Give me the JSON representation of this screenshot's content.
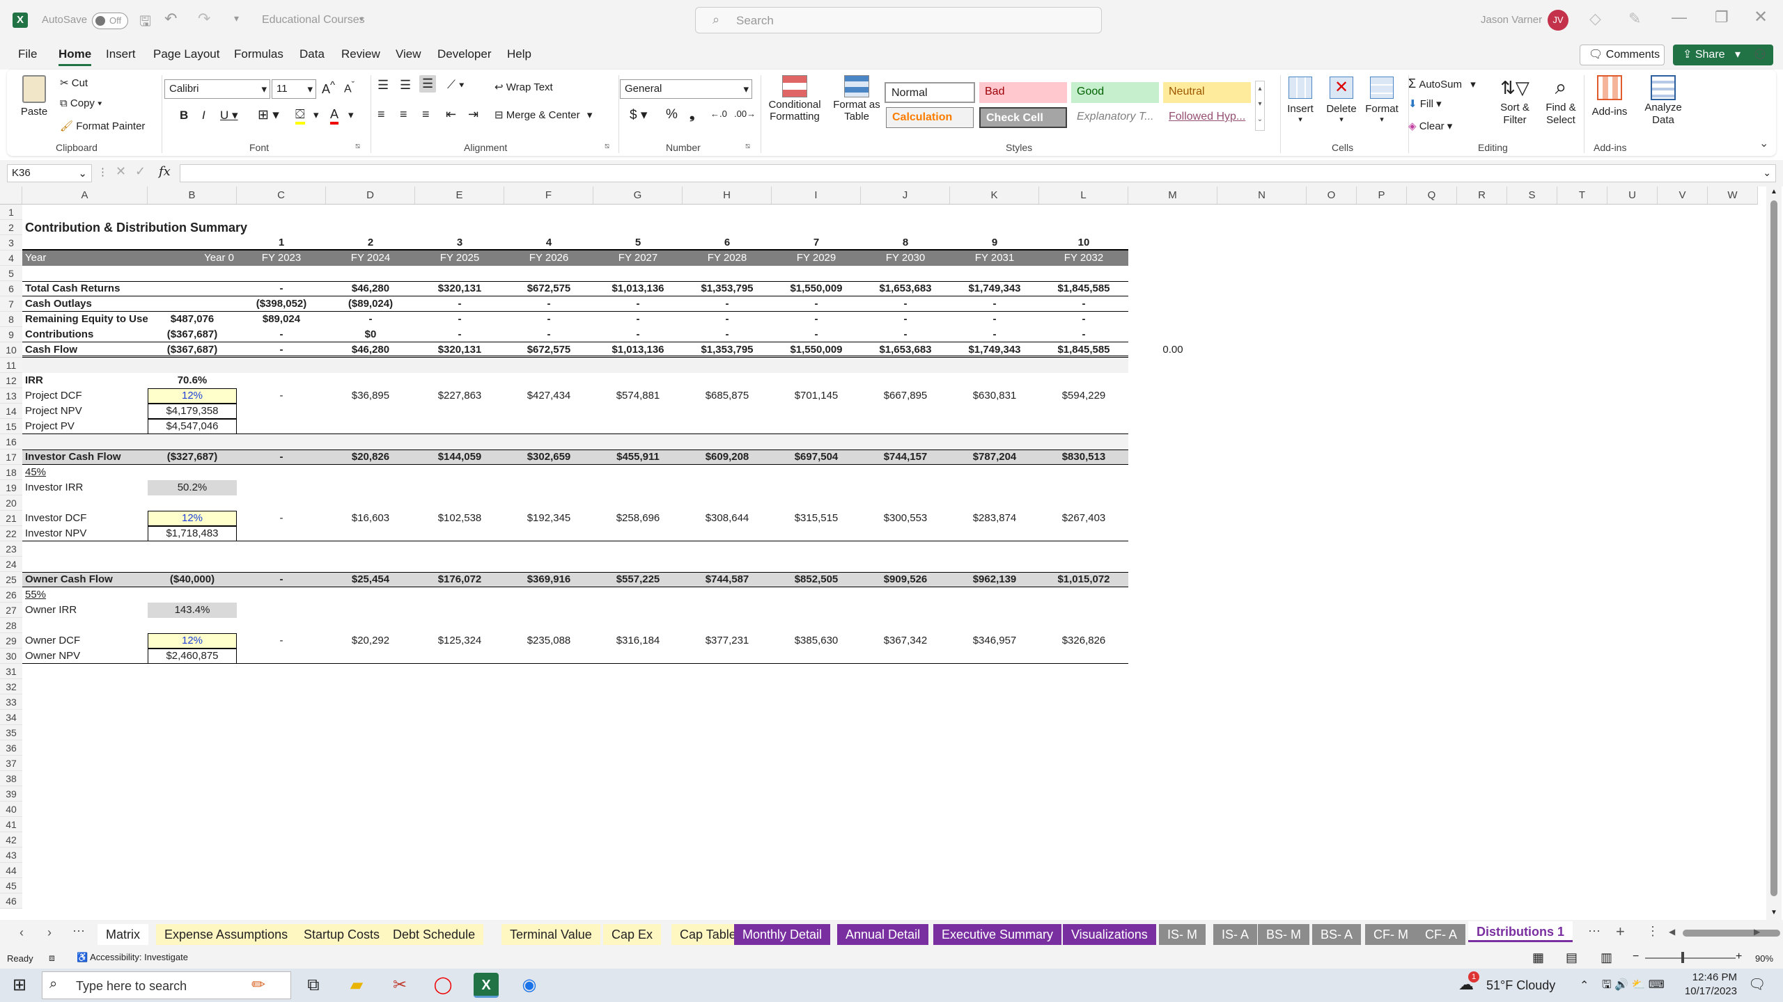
{
  "titlebar": {
    "autosave_label": "AutoSave",
    "autosave_state": "Off",
    "file_name": "Educational Courses",
    "search_placeholder": "Search",
    "user_name": "Jason Varner",
    "user_initials": "JV"
  },
  "menu": [
    "File",
    "Home",
    "Insert",
    "Page Layout",
    "Formulas",
    "Data",
    "Review",
    "View",
    "Developer",
    "Help"
  ],
  "menu_active": "Home",
  "comments_label": "Comments",
  "share_label": "Share",
  "ribbon": {
    "clipboard": {
      "paste": "Paste",
      "cut": "Cut",
      "copy": "Copy",
      "format_painter": "Format Painter",
      "group": "Clipboard"
    },
    "font": {
      "name": "Calibri",
      "size": "11",
      "group": "Font"
    },
    "alignment": {
      "wrap": "Wrap Text",
      "merge": "Merge & Center",
      "group": "Alignment"
    },
    "number": {
      "format": "General",
      "group": "Number"
    },
    "styles": {
      "conditional": "Conditional Formatting",
      "format_table": "Format as Table",
      "normal": "Normal",
      "bad": "Bad",
      "good": "Good",
      "neutral": "Neutral",
      "calculation": "Calculation",
      "check": "Check Cell",
      "explanatory": "Explanatory T...",
      "followed": "Followed Hyp...",
      "group": "Styles"
    },
    "cells": {
      "insert": "Insert",
      "delete": "Delete",
      "format": "Format",
      "group": "Cells"
    },
    "editing": {
      "autosum": "AutoSum",
      "fill": "Fill",
      "clear": "Clear",
      "sort": "Sort & Filter",
      "find": "Find & Select",
      "group": "Editing"
    },
    "addins": {
      "addins": "Add-ins",
      "analyze": "Analyze Data",
      "group": "Add-ins"
    }
  },
  "namebox": "K36",
  "fx": "fx",
  "columns": [
    "A",
    "B",
    "C",
    "D",
    "E",
    "F",
    "G",
    "H",
    "I",
    "J",
    "K",
    "L",
    "M",
    "N",
    "O",
    "P",
    "Q",
    "R",
    "S",
    "T",
    "U",
    "V",
    "W"
  ],
  "rows": {
    "r2": {
      "A": "Contribution & Distribution Summary"
    },
    "r3": {
      "C": "1",
      "D": "2",
      "E": "3",
      "F": "4",
      "G": "5",
      "H": "6",
      "I": "7",
      "J": "8",
      "K": "9",
      "L": "10"
    },
    "r4": {
      "A": "Year",
      "B": "Year 0",
      "C": "FY 2023",
      "D": "FY 2024",
      "E": "FY 2025",
      "F": "FY 2026",
      "G": "FY 2027",
      "H": "FY 2028",
      "I": "FY 2029",
      "J": "FY 2030",
      "K": "FY 2031",
      "L": "FY 2032"
    },
    "r6": {
      "A": "Total Cash Returns",
      "C": "-",
      "D": "$46,280",
      "E": "$320,131",
      "F": "$672,575",
      "G": "$1,013,136",
      "H": "$1,353,795",
      "I": "$1,550,009",
      "J": "$1,653,683",
      "K": "$1,749,343",
      "L": "$1,845,585"
    },
    "r7": {
      "A": "Cash Outlays",
      "C": "($398,052)",
      "D": "($89,024)",
      "E": "-",
      "F": "-",
      "G": "-",
      "H": "-",
      "I": "-",
      "J": "-",
      "K": "-",
      "L": "-"
    },
    "r8": {
      "A": "Remaining Equity to Use",
      "B": "$487,076",
      "C": "$89,024",
      "D": "-",
      "E": "-",
      "F": "-",
      "G": "-",
      "H": "-",
      "I": "-",
      "J": "-",
      "K": "-",
      "L": "-"
    },
    "r9": {
      "A": "Contributions",
      "B": "($367,687)",
      "C": "-",
      "D": "$0",
      "E": "-",
      "F": "-",
      "G": "-",
      "H": "-",
      "I": "-",
      "J": "-",
      "K": "-",
      "L": "-"
    },
    "r10": {
      "A": "Cash Flow",
      "B": "($367,687)",
      "C": "-",
      "D": "$46,280",
      "E": "$320,131",
      "F": "$672,575",
      "G": "$1,013,136",
      "H": "$1,353,795",
      "I": "$1,550,009",
      "J": "$1,653,683",
      "K": "$1,749,343",
      "L": "$1,845,585",
      "M": "0.00"
    },
    "r12": {
      "A": "IRR",
      "B": "70.6%"
    },
    "r13": {
      "A": "Project DCF",
      "B": "12%",
      "C": "-",
      "D": "$36,895",
      "E": "$227,863",
      "F": "$427,434",
      "G": "$574,881",
      "H": "$685,875",
      "I": "$701,145",
      "J": "$667,895",
      "K": "$630,831",
      "L": "$594,229"
    },
    "r14": {
      "A": "Project NPV",
      "B": "$4,179,358"
    },
    "r15": {
      "A": "Project PV",
      "B": "$4,547,046"
    },
    "r17": {
      "A": "Investor Cash Flow",
      "B": "($327,687)",
      "C": "-",
      "D": "$20,826",
      "E": "$144,059",
      "F": "$302,659",
      "G": "$455,911",
      "H": "$609,208",
      "I": "$697,504",
      "J": "$744,157",
      "K": "$787,204",
      "L": "$830,513"
    },
    "r18": {
      "A": "45%"
    },
    "r19": {
      "A": "Investor IRR",
      "B": "50.2%"
    },
    "r21": {
      "A": "Investor DCF",
      "B": "12%",
      "C": "-",
      "D": "$16,603",
      "E": "$102,538",
      "F": "$192,345",
      "G": "$258,696",
      "H": "$308,644",
      "I": "$315,515",
      "J": "$300,553",
      "K": "$283,874",
      "L": "$267,403"
    },
    "r22": {
      "A": "Investor NPV",
      "B": "$1,718,483"
    },
    "r25": {
      "A": "Owner Cash Flow",
      "B": "($40,000)",
      "C": "-",
      "D": "$25,454",
      "E": "$176,072",
      "F": "$369,916",
      "G": "$557,225",
      "H": "$744,587",
      "I": "$852,505",
      "J": "$909,526",
      "K": "$962,139",
      "L": "$1,015,072"
    },
    "r26": {
      "A": "55%"
    },
    "r27": {
      "A": "Owner IRR",
      "B": "143.4%"
    },
    "r29": {
      "A": "Owner DCF",
      "B": "12%",
      "C": "-",
      "D": "$20,292",
      "E": "$125,324",
      "F": "$235,088",
      "G": "$316,184",
      "H": "$377,231",
      "I": "$385,630",
      "J": "$367,342",
      "K": "$346,957",
      "L": "$326,826"
    },
    "r30": {
      "A": "Owner NPV",
      "B": "$2,460,875"
    }
  },
  "tabs": [
    {
      "label": "Matrix",
      "color": "#ffffff",
      "text": "#222"
    },
    {
      "label": "Expense Assumptions",
      "color": "#fff7c2",
      "text": "#222"
    },
    {
      "label": "Startup Costs",
      "color": "#fff7c2",
      "text": "#222"
    },
    {
      "label": "Debt Schedule",
      "color": "#fff7c2",
      "text": "#222"
    },
    {
      "label": "Terminal Value",
      "color": "#fff7c2",
      "text": "#222"
    },
    {
      "label": "Cap Ex",
      "color": "#fff7c2",
      "text": "#222"
    },
    {
      "label": "Cap Table",
      "color": "#fff7c2",
      "text": "#222"
    },
    {
      "label": "Monthly Detail",
      "color": "#7a2fa0",
      "text": "#fff"
    },
    {
      "label": "Annual Detail",
      "color": "#7a2fa0",
      "text": "#fff"
    },
    {
      "label": "Executive Summary",
      "color": "#7a2fa0",
      "text": "#fff"
    },
    {
      "label": "Visualizations",
      "color": "#7a2fa0",
      "text": "#fff"
    },
    {
      "label": "IS- M",
      "color": "#8c8c8c",
      "text": "#fff"
    },
    {
      "label": "IS- A",
      "color": "#8c8c8c",
      "text": "#fff"
    },
    {
      "label": "BS- M",
      "color": "#8c8c8c",
      "text": "#fff"
    },
    {
      "label": "BS- A",
      "color": "#8c8c8c",
      "text": "#fff"
    },
    {
      "label": "CF- M",
      "color": "#8c8c8c",
      "text": "#fff"
    },
    {
      "label": "CF- A",
      "color": "#8c8c8c",
      "text": "#fff"
    },
    {
      "label": "Distributions 1",
      "color": "#ffffff",
      "text": "#7a2fa0"
    }
  ],
  "status": {
    "ready": "Ready",
    "accessibility": "Accessibility: Investigate",
    "zoom": "90%"
  },
  "taskbar": {
    "search_placeholder": "Type here to search",
    "weather": "51°F  Cloudy",
    "time": "12:46 PM",
    "date": "10/17/2023",
    "badge": "1"
  },
  "colors": {
    "accent": "#217346",
    "header_gray": "#7f7f7f",
    "input_yellow": "#ffffcc",
    "calc_gray": "#d9d9d9"
  }
}
